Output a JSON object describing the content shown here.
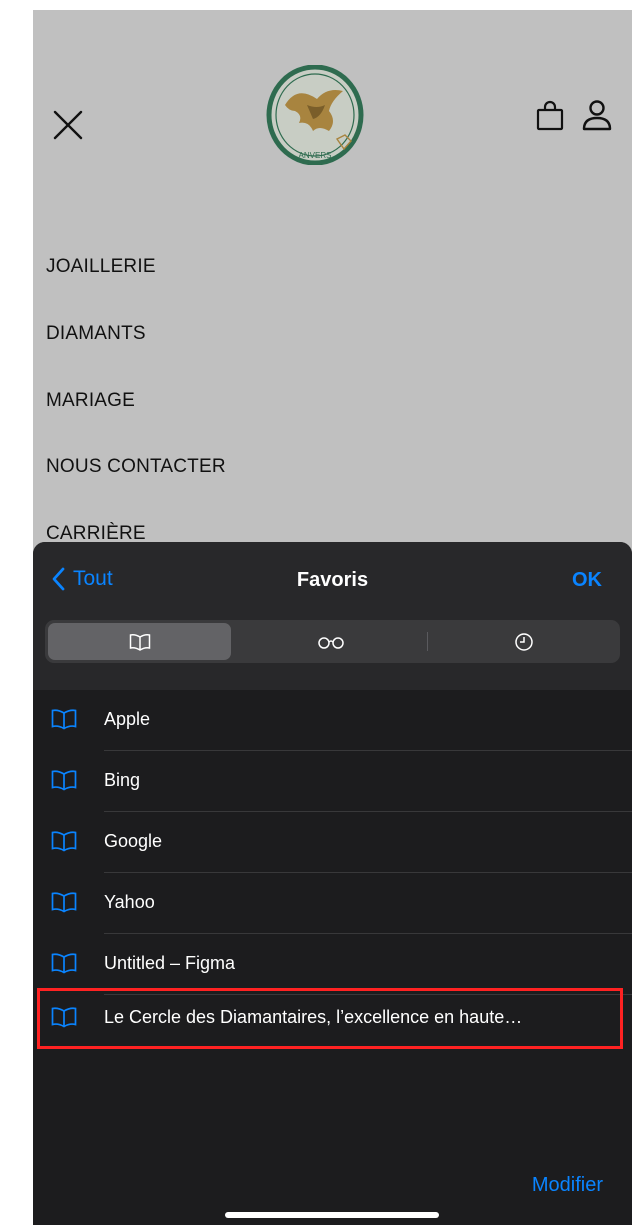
{
  "page": {
    "logo_text": "LE CERCLE DES DIAMANTAIRES ANVERS",
    "header_icons": [
      "close-icon",
      "shopping-bag-icon",
      "user-icon"
    ]
  },
  "menu": {
    "items": [
      {
        "label": "JOAILLERIE"
      },
      {
        "label": "DIAMANTS"
      },
      {
        "label": "MARIAGE"
      },
      {
        "label": "NOUS CONTACTER"
      },
      {
        "label": "CARRIÈRE"
      }
    ]
  },
  "bookmarks_sheet": {
    "back_label": "Tout",
    "title": "Favoris",
    "ok_label": "OK",
    "segments": [
      {
        "icon": "book-icon",
        "selected": true
      },
      {
        "icon": "glasses-icon",
        "selected": false
      },
      {
        "icon": "clock-icon",
        "selected": false
      }
    ],
    "items": [
      {
        "label": "Apple"
      },
      {
        "label": "Bing"
      },
      {
        "label": "Google"
      },
      {
        "label": "Yahoo"
      },
      {
        "label": "Untitled – Figma"
      },
      {
        "label": "Le Cercle des Diamantaires, l’excellence en haute…"
      }
    ],
    "highlighted_index": 5,
    "edit_label": "Modifier"
  },
  "colors": {
    "accent": "#0a84ff",
    "sheet_bg": "#1c1c1e",
    "page_overlay": "#c0c0c0",
    "highlight": "#ff2222",
    "logo_green": "#2e6b4f",
    "logo_gold": "#a8843f"
  }
}
